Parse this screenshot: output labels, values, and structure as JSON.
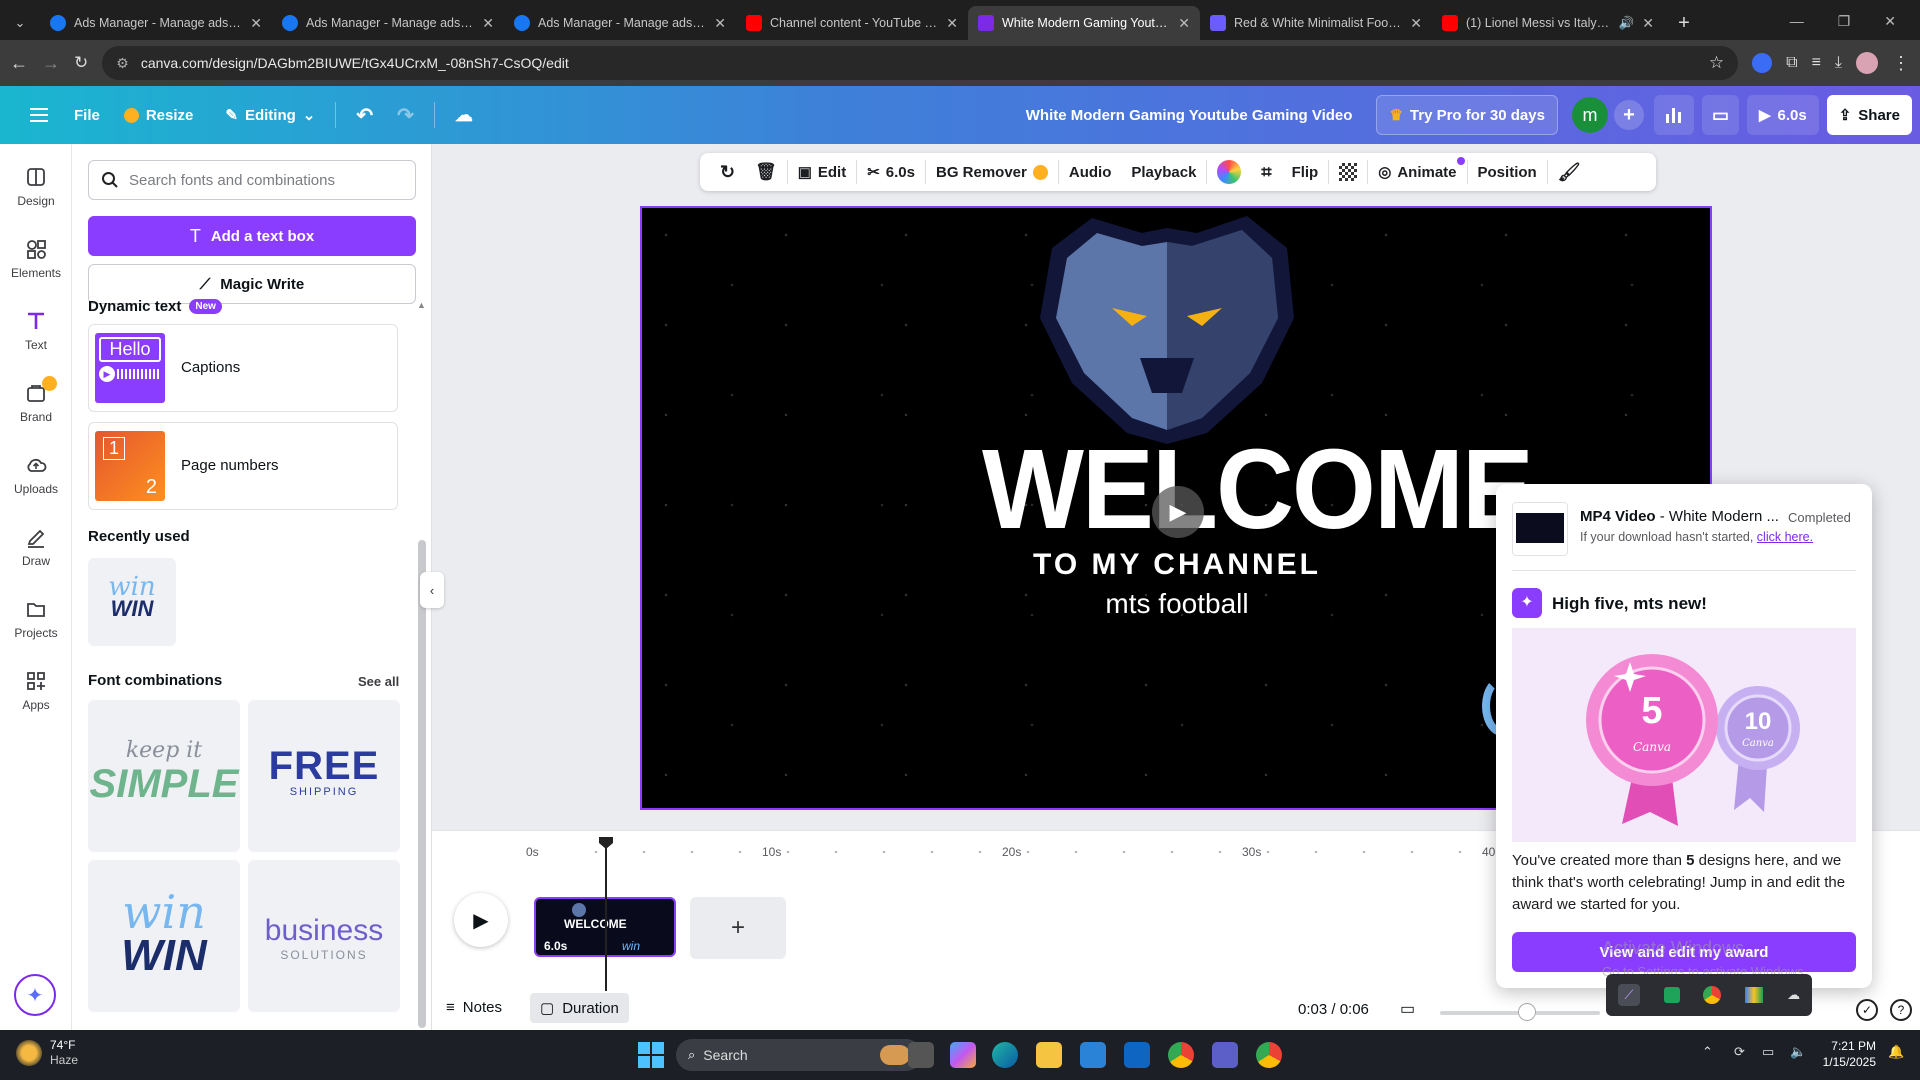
{
  "browser": {
    "tabs": [
      {
        "title": "Ads Manager - Manage ads - C",
        "icon": "meta-icon",
        "color": "#1877f2"
      },
      {
        "title": "Ads Manager - Manage ads - C",
        "icon": "meta-icon",
        "color": "#1877f2"
      },
      {
        "title": "Ads Manager - Manage ads - A",
        "icon": "meta-icon",
        "color": "#1877f2"
      },
      {
        "title": "Channel content - YouTube Stu",
        "icon": "youtube-icon",
        "color": "#ff0000"
      },
      {
        "title": "White Modern Gaming Youtube",
        "icon": "canva-icon",
        "color": "#7d2ae8",
        "active": true
      },
      {
        "title": "Red & White Minimalist Footba",
        "icon": "canva-heart-icon",
        "color": "#6b5cff"
      },
      {
        "title": "(1) Lionel Messi vs Italy | Fin",
        "icon": "youtube-icon",
        "color": "#ff0000"
      }
    ],
    "url": "canva.com/design/DAGbm2BIUWE/tGx4UCrxM_-08nSh7-CsOQ/edit"
  },
  "header": {
    "file": "File",
    "resize": "Resize",
    "editing": "Editing",
    "doc_title": "White Modern Gaming Youtube Gaming Video",
    "try_pro": "Try Pro for 30 days",
    "avatar_letter": "m",
    "play_duration": "6.0s",
    "share": "Share"
  },
  "rail": [
    {
      "label": "Design",
      "icon": "design-icon"
    },
    {
      "label": "Elements",
      "icon": "elements-icon"
    },
    {
      "label": "Text",
      "icon": "text-icon",
      "active": true
    },
    {
      "label": "Brand",
      "icon": "brand-icon"
    },
    {
      "label": "Uploads",
      "icon": "uploads-icon"
    },
    {
      "label": "Draw",
      "icon": "draw-icon"
    },
    {
      "label": "Projects",
      "icon": "projects-icon"
    },
    {
      "label": "Apps",
      "icon": "apps-icon"
    }
  ],
  "panel": {
    "search_placeholder": "Search fonts and combinations",
    "add_text": "Add a text box",
    "magic_write": "Magic Write",
    "dynamic_text": "Dynamic text",
    "new_badge": "New",
    "captions": "Captions",
    "captions_thumb": "Hello",
    "page_numbers": "Page numbers",
    "page_thumb_1": "1",
    "page_thumb_2": "2",
    "recently_used": "Recently used",
    "recent_thumb_a": "win",
    "recent_thumb_b": "WIN",
    "font_combinations": "Font combinations",
    "see_all": "See all",
    "combo_keep_a": "keep it",
    "combo_keep_b": "SIMPLE",
    "combo_free_a": "FREE",
    "combo_free_b": "SHIPPING",
    "combo_win_a": "win",
    "combo_win_b": "WIN",
    "combo_biz_a": "business",
    "combo_biz_b": "SOLUTIONS"
  },
  "toolbar": {
    "edit": "Edit",
    "duration": "6.0s",
    "bg_remover": "BG Remover",
    "audio": "Audio",
    "playback": "Playback",
    "flip": "Flip",
    "animate": "Animate",
    "position": "Position"
  },
  "canvas": {
    "welcome": "WELCOME",
    "to_my_channel": "TO MY CHANNEL",
    "channel_name": "mts football"
  },
  "timeline": {
    "ticks": [
      "0s",
      "10s",
      "20s",
      "30s",
      "40"
    ],
    "clip_duration": "6.0s",
    "clip_welcome": "WELCOME",
    "clip_win": "win",
    "notes": "Notes",
    "duration_btn": "Duration",
    "time": "0:03 / 0:06"
  },
  "popup": {
    "download_title": "MP4 Video",
    "download_title_rest": " - White Modern ...",
    "download_status": "Completed",
    "download_hint": "If your download hasn't started, ",
    "download_link": "click here.",
    "congrats_title": "High five, mts new!",
    "badge_5": "5",
    "badge_5_label": "Canva",
    "badge_10": "10",
    "badge_10_label": "Canva",
    "body_pre": "You've created more than ",
    "body_num": "5",
    "body_post": " designs here, and we think that's worth celebrating! Jump in and edit the award we started for you.",
    "cta": "View and edit my award",
    "watermark_1": "Activate Windows",
    "watermark_2": "Go to Settings to activate Windows."
  },
  "taskbar": {
    "weather_temp": "74°F",
    "weather_desc": "Haze",
    "search": "Search",
    "clock_time": "7:21 PM",
    "clock_date": "1/15/2025"
  }
}
